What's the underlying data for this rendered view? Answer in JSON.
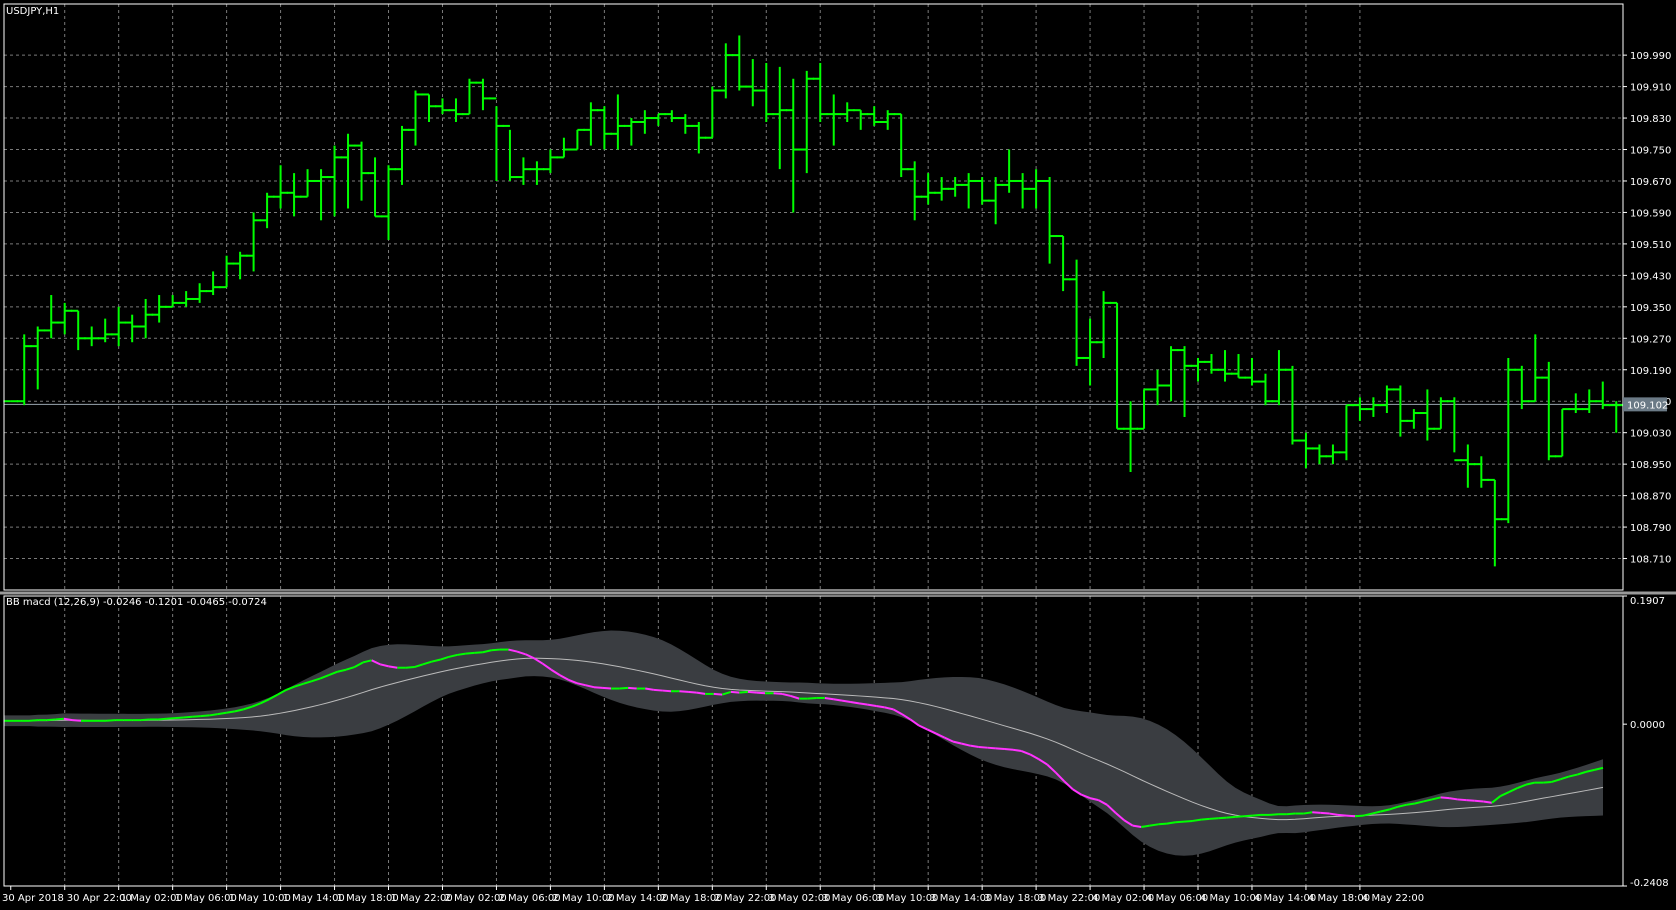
{
  "chart_data": [
    {
      "type": "ohlc",
      "title": "USDJPY,H1",
      "current_price_label": "109.102",
      "ylim": [
        108.63,
        110.12
      ],
      "yticks": [
        "109.990",
        "109.910",
        "109.830",
        "109.750",
        "109.670",
        "109.590",
        "109.510",
        "109.430",
        "109.350",
        "109.270",
        "109.190",
        "109.110",
        "109.030",
        "108.950",
        "108.870",
        "108.790",
        "108.710"
      ],
      "x_labels": [
        "30 Apr 2018",
        "30 Apr 22:00",
        "1 May 02:00",
        "1 May 06:00",
        "1 May 10:00",
        "1 May 14:00",
        "1 May 18:00",
        "1 May 22:00",
        "2 May 02:00",
        "2 May 06:00",
        "2 May 10:00",
        "2 May 14:00",
        "2 May 18:00",
        "2 May 22:00",
        "3 May 02:00",
        "3 May 06:00",
        "3 May 10:00",
        "3 May 14:00",
        "3 May 18:00",
        "3 May 22:00",
        "4 May 02:00",
        "4 May 06:00",
        "4 May 10:00",
        "4 May 14:00",
        "4 May 18:00",
        "4 May 22:00"
      ],
      "bar_color": "#00ff00",
      "ohlc": [
        [
          109.11,
          109.11,
          109.11,
          109.11
        ],
        [
          109.11,
          109.28,
          109.1,
          109.25
        ],
        [
          109.25,
          109.3,
          109.14,
          109.29
        ],
        [
          109.29,
          109.38,
          109.27,
          109.31
        ],
        [
          109.31,
          109.36,
          109.28,
          109.34
        ],
        [
          109.34,
          109.34,
          109.24,
          109.27
        ],
        [
          109.27,
          109.3,
          109.25,
          109.27
        ],
        [
          109.27,
          109.32,
          109.26,
          109.28
        ],
        [
          109.28,
          109.35,
          109.25,
          109.31
        ],
        [
          109.31,
          109.33,
          109.26,
          109.3
        ],
        [
          109.3,
          109.37,
          109.27,
          109.33
        ],
        [
          109.33,
          109.38,
          109.31,
          109.35
        ],
        [
          109.35,
          109.38,
          109.35,
          109.36
        ],
        [
          109.36,
          109.39,
          109.35,
          109.37
        ],
        [
          109.37,
          109.41,
          109.36,
          109.39
        ],
        [
          109.39,
          109.44,
          109.38,
          109.4
        ],
        [
          109.4,
          109.48,
          109.4,
          109.46
        ],
        [
          109.46,
          109.49,
          109.42,
          109.48
        ],
        [
          109.48,
          109.59,
          109.44,
          109.57
        ],
        [
          109.57,
          109.64,
          109.55,
          109.63
        ],
        [
          109.63,
          109.71,
          109.6,
          109.64
        ],
        [
          109.64,
          109.69,
          109.58,
          109.63
        ],
        [
          109.63,
          109.7,
          109.63,
          109.67
        ],
        [
          109.67,
          109.7,
          109.57,
          109.68
        ],
        [
          109.68,
          109.76,
          109.58,
          109.73
        ],
        [
          109.73,
          109.79,
          109.6,
          109.76
        ],
        [
          109.76,
          109.77,
          109.62,
          109.69
        ],
        [
          109.69,
          109.73,
          109.58,
          109.58
        ],
        [
          109.58,
          109.71,
          109.52,
          109.7
        ],
        [
          109.7,
          109.81,
          109.66,
          109.8
        ],
        [
          109.8,
          109.9,
          109.76,
          109.89
        ],
        [
          109.89,
          109.89,
          109.82,
          109.86
        ],
        [
          109.86,
          109.88,
          109.84,
          109.85
        ],
        [
          109.85,
          109.88,
          109.82,
          109.84
        ],
        [
          109.84,
          109.93,
          109.84,
          109.92
        ],
        [
          109.92,
          109.93,
          109.85,
          109.88
        ],
        [
          109.88,
          109.86,
          109.67,
          109.81
        ],
        [
          109.81,
          109.8,
          109.67,
          109.68
        ],
        [
          109.68,
          109.73,
          109.66,
          109.7
        ],
        [
          109.7,
          109.72,
          109.66,
          109.7
        ],
        [
          109.7,
          109.75,
          109.69,
          109.73
        ],
        [
          109.73,
          109.78,
          109.73,
          109.75
        ],
        [
          109.75,
          109.8,
          109.75,
          109.8
        ],
        [
          109.8,
          109.87,
          109.76,
          109.85
        ],
        [
          109.85,
          109.86,
          109.75,
          109.79
        ],
        [
          109.79,
          109.89,
          109.75,
          109.81
        ],
        [
          109.81,
          109.83,
          109.76,
          109.82
        ],
        [
          109.82,
          109.85,
          109.79,
          109.83
        ],
        [
          109.83,
          109.84,
          109.81,
          109.84
        ],
        [
          109.84,
          109.85,
          109.82,
          109.83
        ],
        [
          109.83,
          109.84,
          109.79,
          109.81
        ],
        [
          109.81,
          109.82,
          109.74,
          109.78
        ],
        [
          109.78,
          109.91,
          109.78,
          109.9
        ],
        [
          109.9,
          110.02,
          109.88,
          109.99
        ],
        [
          109.99,
          110.04,
          109.9,
          109.91
        ],
        [
          109.91,
          109.98,
          109.86,
          109.9
        ],
        [
          109.9,
          109.97,
          109.82,
          109.84
        ],
        [
          109.84,
          109.96,
          109.7,
          109.85
        ],
        [
          109.85,
          109.93,
          109.59,
          109.75
        ],
        [
          109.75,
          109.95,
          109.69,
          109.93
        ],
        [
          109.93,
          109.97,
          109.82,
          109.84
        ],
        [
          109.84,
          109.89,
          109.76,
          109.84
        ],
        [
          109.84,
          109.87,
          109.82,
          109.85
        ],
        [
          109.85,
          109.85,
          109.8,
          109.84
        ],
        [
          109.84,
          109.86,
          109.81,
          109.82
        ],
        [
          109.82,
          109.85,
          109.8,
          109.84
        ],
        [
          109.84,
          109.84,
          109.68,
          109.7
        ],
        [
          109.7,
          109.72,
          109.57,
          109.63
        ],
        [
          109.63,
          109.69,
          109.61,
          109.64
        ],
        [
          109.64,
          109.68,
          109.62,
          109.65
        ],
        [
          109.65,
          109.68,
          109.63,
          109.66
        ],
        [
          109.66,
          109.69,
          109.6,
          109.67
        ],
        [
          109.67,
          109.68,
          109.61,
          109.62
        ],
        [
          109.62,
          109.68,
          109.56,
          109.66
        ],
        [
          109.66,
          109.75,
          109.64,
          109.67
        ],
        [
          109.67,
          109.69,
          109.6,
          109.65
        ],
        [
          109.65,
          109.7,
          109.6,
          109.67
        ],
        [
          109.67,
          109.68,
          109.46,
          109.53
        ],
        [
          109.53,
          109.53,
          109.39,
          109.42
        ],
        [
          109.42,
          109.47,
          109.2,
          109.22
        ],
        [
          109.22,
          109.32,
          109.15,
          109.26
        ],
        [
          109.26,
          109.39,
          109.22,
          109.36
        ],
        [
          109.36,
          109.36,
          109.04,
          109.04
        ],
        [
          109.04,
          109.11,
          108.93,
          109.04
        ],
        [
          109.04,
          109.14,
          109.04,
          109.14
        ],
        [
          109.14,
          109.19,
          109.1,
          109.15
        ],
        [
          109.15,
          109.25,
          109.11,
          109.24
        ],
        [
          109.24,
          109.25,
          109.07,
          109.2
        ],
        [
          109.2,
          109.22,
          109.16,
          109.21
        ],
        [
          109.21,
          109.23,
          109.18,
          109.19
        ],
        [
          109.19,
          109.24,
          109.16,
          109.18
        ],
        [
          109.18,
          109.23,
          109.17,
          109.17
        ],
        [
          109.17,
          109.22,
          109.15,
          109.16
        ],
        [
          109.16,
          109.18,
          109.1,
          109.11
        ],
        [
          109.11,
          109.24,
          109.1,
          109.19
        ],
        [
          109.19,
          109.2,
          109.0,
          109.01
        ],
        [
          109.01,
          109.03,
          108.94,
          108.99
        ],
        [
          108.99,
          109.0,
          108.95,
          108.97
        ],
        [
          108.97,
          109.0,
          108.95,
          108.98
        ],
        [
          108.98,
          109.1,
          108.96,
          109.1
        ],
        [
          109.1,
          109.12,
          109.06,
          109.09
        ],
        [
          109.09,
          109.12,
          109.07,
          109.1
        ],
        [
          109.1,
          109.15,
          109.08,
          109.14
        ],
        [
          109.14,
          109.15,
          109.02,
          109.06
        ],
        [
          109.06,
          109.09,
          109.04,
          109.08
        ],
        [
          109.08,
          109.14,
          109.01,
          109.04
        ],
        [
          109.04,
          109.12,
          109.04,
          109.11
        ],
        [
          109.11,
          109.12,
          108.98,
          108.96
        ],
        [
          108.96,
          109.0,
          108.89,
          108.95
        ],
        [
          108.95,
          108.97,
          108.89,
          108.91
        ],
        [
          108.91,
          108.91,
          108.69,
          108.81
        ],
        [
          108.81,
          109.22,
          108.8,
          109.19
        ],
        [
          109.19,
          109.2,
          109.09,
          109.11
        ],
        [
          109.11,
          109.28,
          109.11,
          109.17
        ],
        [
          109.17,
          109.21,
          108.96,
          108.97
        ],
        [
          108.97,
          109.09,
          108.97,
          109.09
        ],
        [
          109.09,
          109.13,
          109.08,
          109.09
        ],
        [
          109.09,
          109.14,
          109.08,
          109.11
        ],
        [
          109.11,
          109.16,
          109.09,
          109.1
        ],
        [
          109.1,
          109.11,
          109.03,
          109.1
        ]
      ]
    },
    {
      "type": "line",
      "title": "BB macd (12,26,9) -0.0246 -0.1201 -0.0465 -0.0724",
      "ylim": [
        -0.2408,
        0.1907
      ],
      "yticks": [
        "0.1907",
        "0.0000",
        "-0.2408"
      ],
      "colors": {
        "rising": "#00ff00",
        "falling": "#ff33ff",
        "signal": "#bbbbbb",
        "band": "#3a3d41"
      },
      "macd": [
        0.005,
        0.005,
        0.005,
        0.005,
        0.006,
        0.006,
        0.007,
        0.008,
        0.006,
        0.005,
        0.005,
        0.005,
        0.005,
        0.006,
        0.006,
        0.006,
        0.006,
        0.007,
        0.007,
        0.008,
        0.009,
        0.01,
        0.011,
        0.012,
        0.013,
        0.015,
        0.017,
        0.019,
        0.022,
        0.026,
        0.031,
        0.037,
        0.044,
        0.051,
        0.056,
        0.06,
        0.064,
        0.068,
        0.073,
        0.078,
        0.081,
        0.085,
        0.092,
        0.095,
        0.089,
        0.086,
        0.084,
        0.084,
        0.085,
        0.089,
        0.093,
        0.096,
        0.1,
        0.103,
        0.105,
        0.106,
        0.107,
        0.11,
        0.111,
        0.111,
        0.108,
        0.104,
        0.098,
        0.09,
        0.081,
        0.073,
        0.066,
        0.061,
        0.058,
        0.055,
        0.054,
        0.053,
        0.053,
        0.054,
        0.053,
        0.053,
        0.051,
        0.05,
        0.049,
        0.049,
        0.048,
        0.047,
        0.045,
        0.045,
        0.044,
        0.048,
        0.047,
        0.048,
        0.047,
        0.046,
        0.046,
        0.045,
        0.042,
        0.038,
        0.038,
        0.039,
        0.039,
        0.037,
        0.035,
        0.033,
        0.031,
        0.029,
        0.027,
        0.025,
        0.022,
        0.015,
        0.007,
        -0.002,
        -0.008,
        -0.014,
        -0.02,
        -0.026,
        -0.029,
        -0.032,
        -0.034,
        -0.035,
        -0.036,
        -0.037,
        -0.038,
        -0.04,
        -0.045,
        -0.052,
        -0.06,
        -0.072,
        -0.085,
        -0.097,
        -0.105,
        -0.11,
        -0.113,
        -0.12,
        -0.132,
        -0.143,
        -0.151,
        -0.153,
        -0.151,
        -0.149,
        -0.148,
        -0.146,
        -0.145,
        -0.144,
        -0.142,
        -0.141,
        -0.14,
        -0.139,
        -0.138,
        -0.137,
        -0.136,
        -0.135,
        -0.135,
        -0.134,
        -0.134,
        -0.133,
        -0.133,
        -0.131,
        -0.132,
        -0.133,
        -0.135,
        -0.136,
        -0.137,
        -0.136,
        -0.133,
        -0.13,
        -0.127,
        -0.123,
        -0.12,
        -0.118,
        -0.115,
        -0.112,
        -0.109,
        -0.11,
        -0.112,
        -0.113,
        -0.114,
        -0.115,
        -0.117,
        -0.107,
        -0.101,
        -0.095,
        -0.09,
        -0.087,
        -0.087,
        -0.086,
        -0.082,
        -0.078,
        -0.075,
        -0.071,
        -0.068,
        -0.065
      ]
    }
  ]
}
